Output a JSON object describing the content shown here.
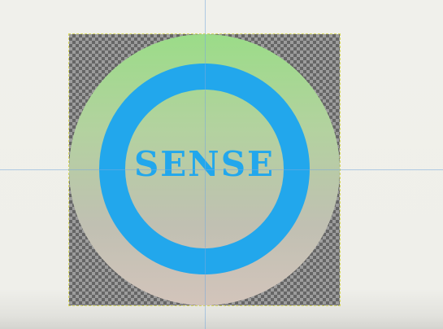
{
  "canvas": {
    "logo_text": "SENSE",
    "ring_color": "#22a7ec",
    "gradient_colors": [
      "#9bdc88",
      "#c0c0b2",
      "#d3c4bb"
    ],
    "transparency": "checkerboard"
  },
  "guides": {
    "vertical": "guide-line",
    "horizontal": "guide-line"
  }
}
